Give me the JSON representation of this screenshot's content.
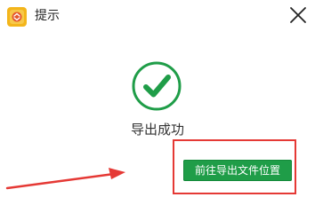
{
  "window": {
    "title": "提示",
    "app_icon": "app-logo-icon",
    "close_icon": "close-icon"
  },
  "status": {
    "icon": "check-circle-icon",
    "message": "导出成功",
    "color": "#1f9d48"
  },
  "actions": {
    "open_location_label": "前往导出文件位置"
  },
  "annotations": {
    "highlight_color": "#e53935",
    "arrow_color": "#e53935"
  }
}
